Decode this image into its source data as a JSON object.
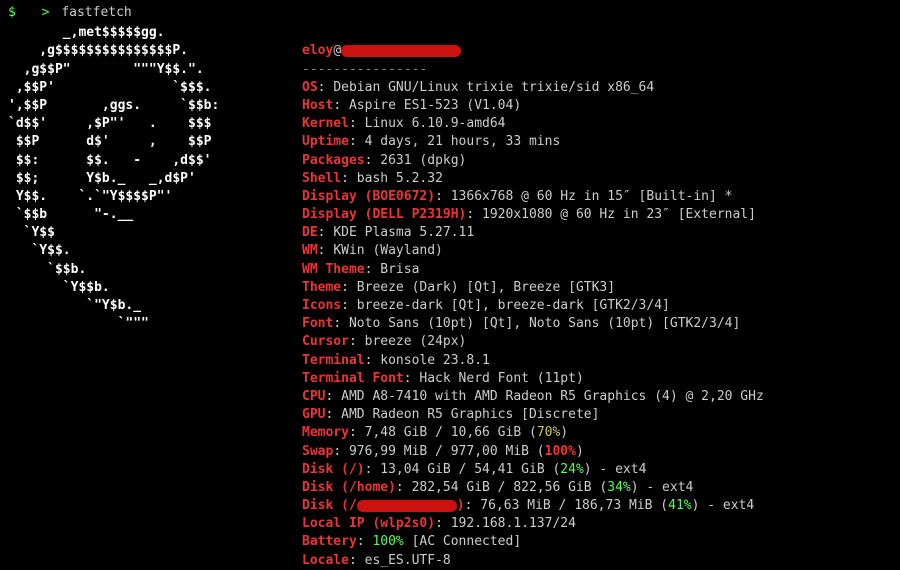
{
  "command": {
    "prompt_dollar": "$",
    "prompt_gt": ">",
    "text": "fastfetch"
  },
  "logo_ascii": "       _,met$$$$$gg.\n    ,g$$$$$$$$$$$$$$$P.\n  ,g$$P\"        \"\"\"Y$$.\".\n ,$$P'               `$$$.\n',$$P       ,ggs.     `$$b:\n`d$$'     ,$P\"'   .    $$$\n $$P      d$'     ,    $$P\n $$:      $$.   -    ,d$$'\n $$;      Y$b._   _,d$P'\n Y$$.    `.`\"Y$$$$P\"'\n `$$b      \"-.__\n  `Y$$\n   `Y$$.\n     `$$b.\n       `Y$$b.\n          `\"Y$b._\n              `\"\"\"",
  "header": {
    "user": "eloy",
    "at": "@",
    "sep": "----------------"
  },
  "rows": [
    {
      "k": "OS",
      "v": "Debian GNU/Linux trixie trixie/sid x86_64"
    },
    {
      "k": "Host",
      "v": "Aspire ES1-523 (V1.04)"
    },
    {
      "k": "Kernel",
      "v": "Linux 6.10.9-amd64"
    },
    {
      "k": "Uptime",
      "v": "4 days, 21 hours, 33 mins"
    },
    {
      "k": "Packages",
      "v": "2631 (dpkg)"
    },
    {
      "k": "Shell",
      "v": "bash 5.2.32"
    },
    {
      "k": "Display (BOE0672)",
      "v": "1366x768 @ 60 Hz in 15″ [Built-in] *"
    },
    {
      "k": "Display (DELL P2319H)",
      "v": "1920x1080 @ 60 Hz in 23″ [External]"
    },
    {
      "k": "DE",
      "v": "KDE Plasma 5.27.11"
    },
    {
      "k": "WM",
      "v": "KWin (Wayland)"
    },
    {
      "k": "WM Theme",
      "v": "Brisa"
    },
    {
      "k": "Theme",
      "v": "Breeze (Dark) [Qt], Breeze [GTK3]"
    },
    {
      "k": "Icons",
      "v": "breeze-dark [Qt], breeze-dark [GTK2/3/4]"
    },
    {
      "k": "Font",
      "v": "Noto Sans (10pt) [Qt], Noto Sans (10pt) [GTK2/3/4]"
    },
    {
      "k": "Cursor",
      "v": "breeze (24px)"
    },
    {
      "k": "Terminal",
      "v": "konsole 23.8.1"
    },
    {
      "k": "Terminal Font",
      "v": "Hack Nerd Font (11pt)"
    },
    {
      "k": "CPU",
      "v": "AMD A8-7410 with AMD Radeon R5 Graphics (4) @ 2,20 GHz"
    },
    {
      "k": "GPU",
      "v": "AMD Radeon R5 Graphics [Discrete]"
    }
  ],
  "memory": {
    "k": "Memory",
    "pre": "7,48 GiB / 10,66 GiB (",
    "pct": "70%",
    "pct_class": "y",
    "post": ")"
  },
  "swap": {
    "k": "Swap",
    "pre": "976,99 MiB / 977,00 MiB (",
    "pct": "100%",
    "pct_class": "k",
    "post": ")"
  },
  "disk_root": {
    "k": "Disk (/)",
    "pre": "13,04 GiB / 54,41 GiB (",
    "pct": "24%",
    "pct_class": "g",
    "post": ") - ext4"
  },
  "disk_home": {
    "k": "Disk (/home)",
    "pre": "282,54 GiB / 822,56 GiB (",
    "pct": "34%",
    "pct_class": "g",
    "post": ") - ext4"
  },
  "disk_redact": {
    "k_pre": "Disk (/",
    "k_post": ")",
    "pre": "76,63 MiB / 186,73 MiB (",
    "pct": "41%",
    "pct_class": "g",
    "post": ") - ext4"
  },
  "local_ip": {
    "k": "Local IP (wlp2s0)",
    "v": "192.168.1.137/24"
  },
  "battery": {
    "k": "Battery",
    "pct": "100%",
    "post": " [AC Connected]"
  },
  "locale": {
    "k": "Locale",
    "v": "es_ES.UTF-8"
  },
  "colon": ": "
}
